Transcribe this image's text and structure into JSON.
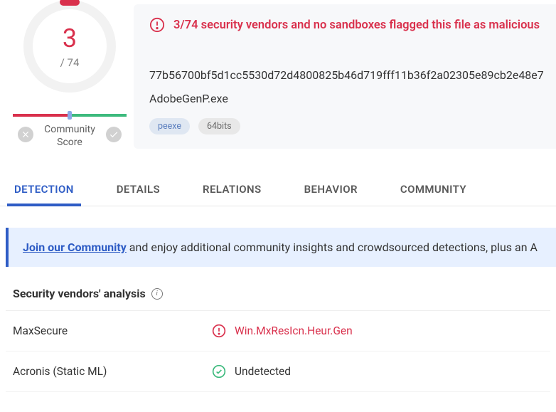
{
  "score": {
    "value": "3",
    "denominator": "/ 74",
    "community_label": "Community\nScore"
  },
  "alert": {
    "text": "3/74 security vendors and no sandboxes flagged this file as malicious"
  },
  "file": {
    "hash": "77b56700bf5d1cc5530d72d4800825b46d719fff11b36f2a02305e89cb2e48e7",
    "name": "AdobeGenP.exe"
  },
  "tags": [
    "peexe",
    "64bits"
  ],
  "tabs": [
    "DETECTION",
    "DETAILS",
    "RELATIONS",
    "BEHAVIOR",
    "COMMUNITY"
  ],
  "active_tab": 0,
  "banner": {
    "link_text": "Join our Community",
    "rest": " and enjoy additional community insights and crowdsourced detections, plus an A"
  },
  "analysis": {
    "header": "Security vendors' analysis",
    "vendors": [
      {
        "name": "MaxSecure",
        "result": "Win.MxResIcn.Heur.Gen",
        "status": "malicious"
      },
      {
        "name": "Acronis (Static ML)",
        "result": "Undetected",
        "status": "clean"
      }
    ]
  }
}
